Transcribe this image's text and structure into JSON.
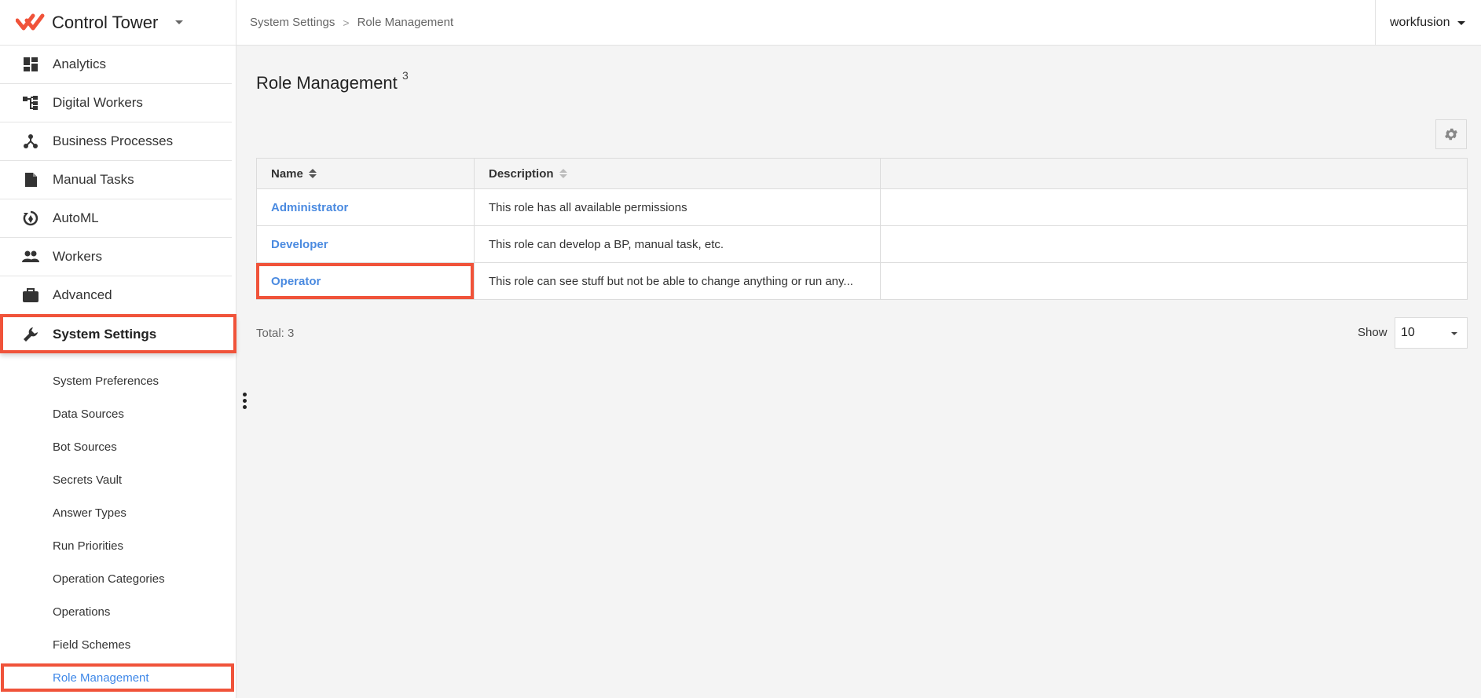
{
  "app": {
    "name": "Control Tower"
  },
  "breadcrumb": [
    "System Settings",
    "Role Management"
  ],
  "user": {
    "name": "workfusion"
  },
  "nav": {
    "items": [
      {
        "label": "Analytics",
        "icon": "dashboard-icon"
      },
      {
        "label": "Digital Workers",
        "icon": "hierarchy-icon"
      },
      {
        "label": "Business Processes",
        "icon": "process-nodes-icon"
      },
      {
        "label": "Manual Tasks",
        "icon": "document-icon"
      },
      {
        "label": "AutoML",
        "icon": "automl-cycle-icon"
      },
      {
        "label": "Workers",
        "icon": "people-icon"
      },
      {
        "label": "Advanced",
        "icon": "briefcase-icon"
      },
      {
        "label": "System Settings",
        "icon": "wrench-icon"
      }
    ],
    "sub_items": [
      "System Preferences",
      "Data Sources",
      "Bot Sources",
      "Secrets Vault",
      "Answer Types",
      "Run Priorities",
      "Operation Categories",
      "Operations",
      "Field Schemes",
      "Role Management"
    ]
  },
  "page": {
    "title": "Role Management",
    "count": "3"
  },
  "table": {
    "columns": [
      "Name",
      "Description"
    ],
    "rows": [
      {
        "name": "Administrator",
        "description": "This role has all available permissions"
      },
      {
        "name": "Developer",
        "description": "This role can develop a BP, manual task, etc."
      },
      {
        "name": "Operator",
        "description": "This role can see stuff but not be able to change anything or run any..."
      }
    ]
  },
  "footer": {
    "total": "Total: 3",
    "show_label": "Show",
    "page_size": "10"
  },
  "colors": {
    "brand": "#f0533a",
    "link": "#4a8ae0",
    "highlight": "#f0533a"
  }
}
